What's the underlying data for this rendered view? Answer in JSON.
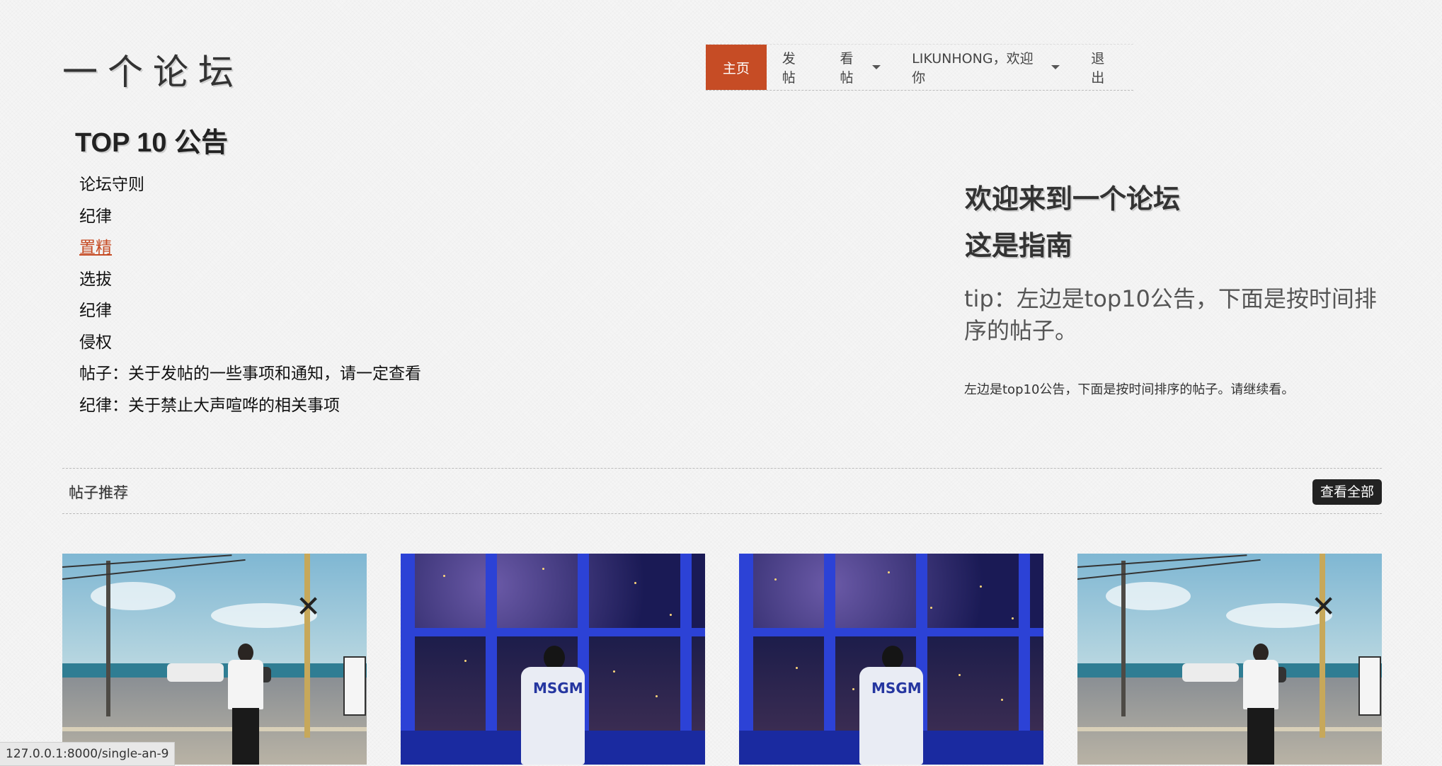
{
  "site": {
    "logo": "一个论坛"
  },
  "nav": {
    "items": [
      {
        "label": "主页",
        "active": true,
        "dropdown": false
      },
      {
        "label": "发帖",
        "active": false,
        "dropdown": false
      },
      {
        "label": "看帖",
        "active": false,
        "dropdown": true
      },
      {
        "label": "LIKUNHONG，欢迎你",
        "active": false,
        "dropdown": true
      },
      {
        "label": "退出",
        "active": false,
        "dropdown": false
      }
    ]
  },
  "notices": {
    "title": "TOP 10 公告",
    "items": [
      "论坛守则",
      "纪律",
      "置精",
      "选拔",
      "纪律",
      "侵权",
      "帖子：关于发帖的一些事项和通知，请一定查看",
      "纪律：关于禁止大声喧哗的相关事项"
    ],
    "highlighted_index": 2
  },
  "welcome": {
    "line1": "欢迎来到一个论坛",
    "line2": "这是指南",
    "tip": "tip：左边是top10公告，下面是按时间排序的帖子。",
    "note": "左边是top10公告，下面是按时间排序的帖子。请继续看。"
  },
  "posts_section": {
    "title": "帖子推荐",
    "view_all": "查看全部"
  },
  "cards": [
    "beach",
    "night-city",
    "night-city",
    "beach"
  ],
  "status_bar": {
    "url": "127.0.0.1:8000/single-an-9"
  },
  "colors": {
    "accent": "#c64c25",
    "dark_button": "#222222"
  }
}
